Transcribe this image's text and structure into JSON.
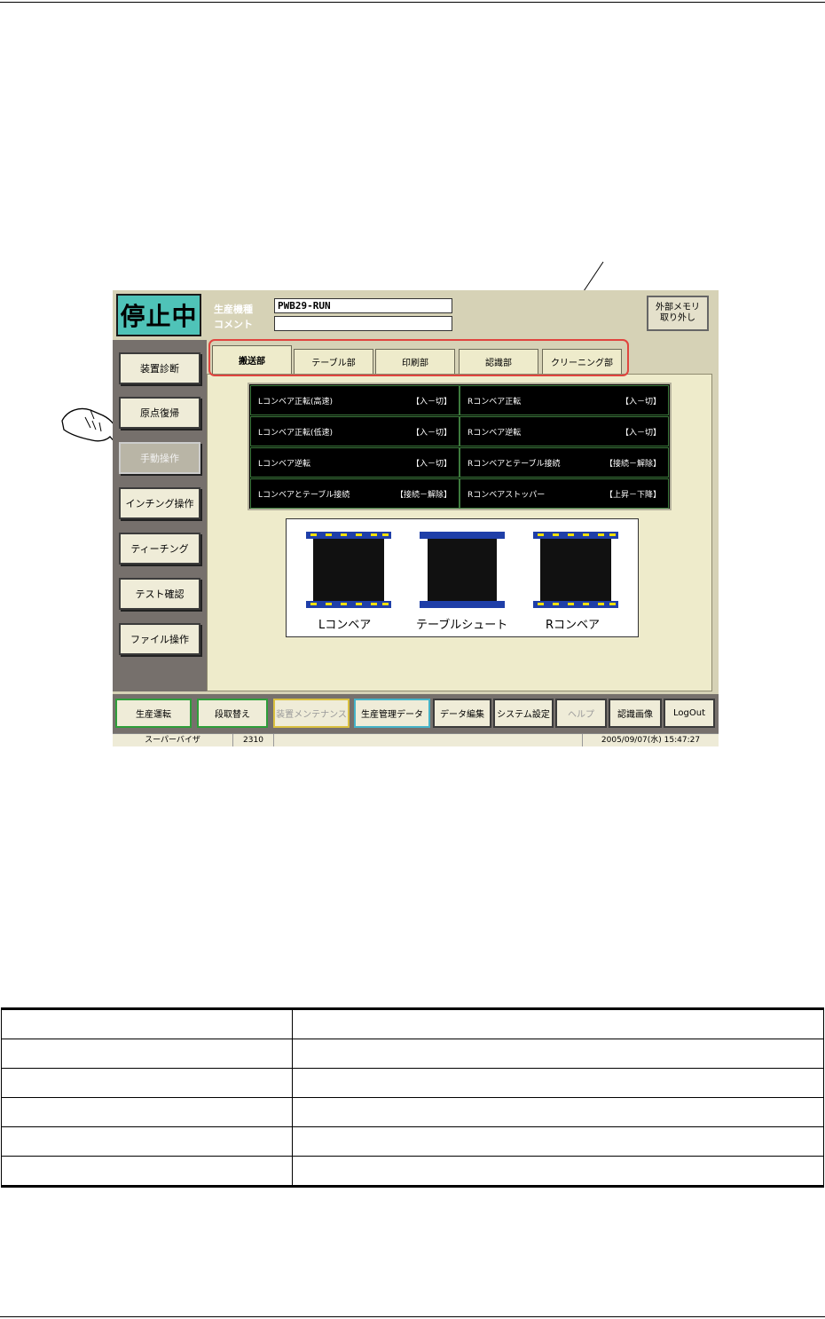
{
  "status": {
    "text": "停止中"
  },
  "header": {
    "model_label": "生産機種",
    "model_value": "PWB29-RUN",
    "comment_label": "コメント",
    "comment_value": "",
    "memory_button": "外部メモリ\n取り外し"
  },
  "side_menu": [
    {
      "label": "装置診断",
      "active": false
    },
    {
      "label": "原点復帰",
      "active": false
    },
    {
      "label": "手動操作",
      "active": true
    },
    {
      "label": "インチング操作",
      "active": false
    },
    {
      "label": "ティーチング",
      "active": false
    },
    {
      "label": "テスト確認",
      "active": false
    },
    {
      "label": "ファイル操作",
      "active": false
    }
  ],
  "tabs": [
    {
      "label": "搬送部",
      "active": true
    },
    {
      "label": "テーブル部",
      "active": false
    },
    {
      "label": "印刷部",
      "active": false
    },
    {
      "label": "認識部",
      "active": false
    },
    {
      "label": "クリーニング部",
      "active": false
    }
  ],
  "operations": [
    {
      "name": "Lコンベア正転(高速)",
      "state": "【入－切】"
    },
    {
      "name": "Rコンベア正転",
      "state": "【入－切】"
    },
    {
      "name": "Lコンベア正転(低速)",
      "state": "【入－切】"
    },
    {
      "name": "Rコンベア逆転",
      "state": "【入－切】"
    },
    {
      "name": "Lコンベア逆転",
      "state": "【入－切】"
    },
    {
      "name": "Rコンベアとテーブル接続",
      "state": "【接続－解除】"
    },
    {
      "name": "Lコンベアとテーブル接続",
      "state": "【接続－解除】"
    },
    {
      "name": "Rコンベアストッパー",
      "state": "【上昇－下降】"
    }
  ],
  "diagram": {
    "labels": [
      "Lコンベア",
      "テーブルシュート",
      "Rコンベア"
    ],
    "colors": {
      "frame": "#1f3fa8",
      "marker": "#f2e000",
      "body": "#111111"
    }
  },
  "bottom_menu": [
    {
      "label": "生産運転",
      "disabled": false
    },
    {
      "label": "段取替え",
      "disabled": false
    },
    {
      "label": "装置メンテナンス",
      "disabled": true
    },
    {
      "label": "生産管理データ",
      "disabled": false
    },
    {
      "label": "データ編集",
      "disabled": false
    },
    {
      "label": "システム設定",
      "disabled": false
    },
    {
      "label": "ヘルプ",
      "disabled": true
    },
    {
      "label": "認識画像",
      "disabled": false
    },
    {
      "label": "LogOut",
      "disabled": false
    }
  ],
  "status_bar": {
    "user": "スーパーバイザ",
    "code": "2310",
    "datetime": "2005/09/07(水) 15:47:27"
  },
  "icons": [
    "pointing-hand-icon",
    "callout-arrow-icon"
  ]
}
